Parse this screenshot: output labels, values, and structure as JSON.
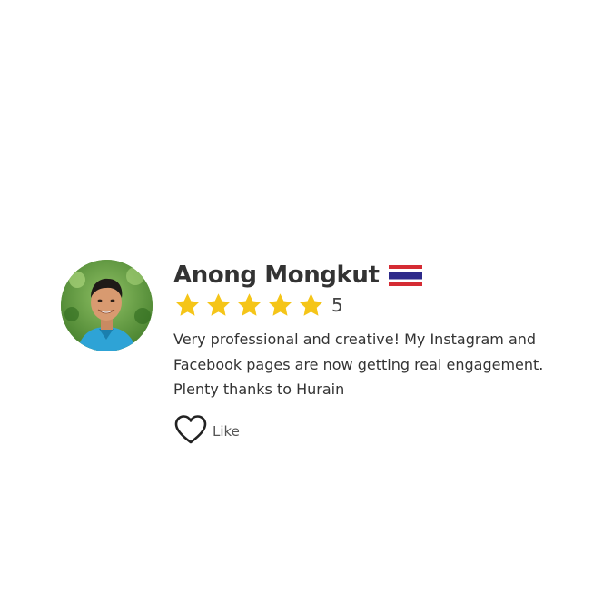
{
  "review": {
    "reviewer_name": "Anong Mongkut",
    "country_flag_icon": "thailand-flag-icon",
    "star_color": "#F5C518",
    "stars": 5,
    "rating_label": "5",
    "text": "Very professional and creative! My Instagram and Facebook pages are now getting real engagement. Plenty thanks to Hurain",
    "like_label": "Like",
    "like_icon": "heart-outline-icon"
  }
}
